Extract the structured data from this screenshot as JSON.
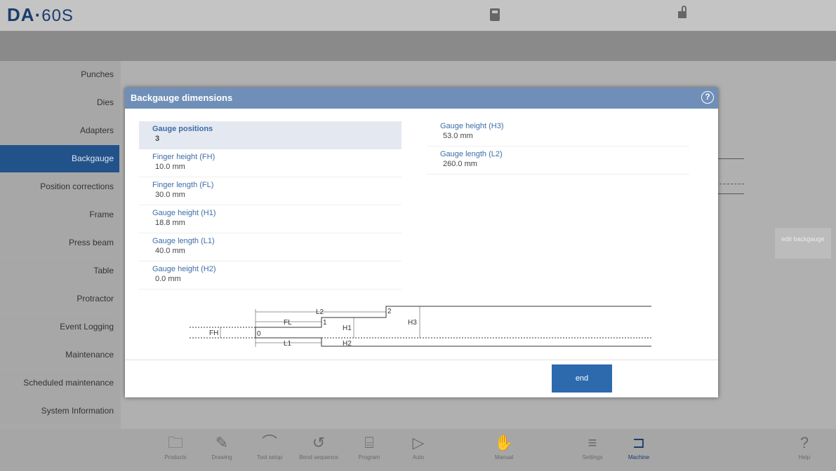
{
  "app": {
    "logo_brand": "DA",
    "logo_sep": "·",
    "logo_model": "60S"
  },
  "sidebar": {
    "items": [
      {
        "label": "Punches"
      },
      {
        "label": "Dies"
      },
      {
        "label": "Adapters"
      },
      {
        "label": "Backgauge"
      },
      {
        "label": "Position corrections"
      },
      {
        "label": "Frame"
      },
      {
        "label": "Press beam"
      },
      {
        "label": "Table"
      },
      {
        "label": "Protractor"
      },
      {
        "label": "Event Logging"
      },
      {
        "label": "Maintenance"
      },
      {
        "label": "Scheduled maintenance"
      },
      {
        "label": "System Information"
      }
    ],
    "active": "Backgauge"
  },
  "background": {
    "edit_button": "edit backgauge"
  },
  "dialog": {
    "title": "Backgauge dimensions",
    "left_params": [
      {
        "label": "Gauge positions",
        "value": "3"
      },
      {
        "label": "Finger height (FH)",
        "value": "10.0 mm"
      },
      {
        "label": "Finger length (FL)",
        "value": "30.0 mm"
      },
      {
        "label": "Gauge height (H1)",
        "value": "18.8 mm"
      },
      {
        "label": "Gauge length (L1)",
        "value": "40.0 mm"
      },
      {
        "label": "Gauge height (H2)",
        "value": "0.0 mm"
      }
    ],
    "right_params": [
      {
        "label": "Gauge height (H3)",
        "value": "53.0 mm"
      },
      {
        "label": "Gauge length (L2)",
        "value": "260.0 mm"
      }
    ],
    "diagram_labels": {
      "fh": "FH",
      "fl": "FL",
      "l1": "L1",
      "l2": "L2",
      "h1": "H1",
      "h2": "H2",
      "h3": "H3",
      "p0": "0",
      "p1": "1",
      "p2": "2"
    },
    "end_button": "end"
  },
  "bottom_bar": [
    {
      "label": "Products",
      "icon": "folder-icon"
    },
    {
      "label": "Drawing",
      "icon": "drawing-icon"
    },
    {
      "label": "Tool setup",
      "icon": "tool-setup-icon"
    },
    {
      "label": "Bend sequence",
      "icon": "bend-sequence-icon"
    },
    {
      "label": "Program",
      "icon": "program-icon"
    },
    {
      "label": "Auto",
      "icon": "play-icon"
    },
    {
      "label": "Manual",
      "icon": "hand-icon"
    },
    {
      "label": "Settings",
      "icon": "list-icon"
    },
    {
      "label": "Machine",
      "icon": "machine-icon"
    },
    {
      "label": "Help",
      "icon": "help-icon"
    }
  ]
}
